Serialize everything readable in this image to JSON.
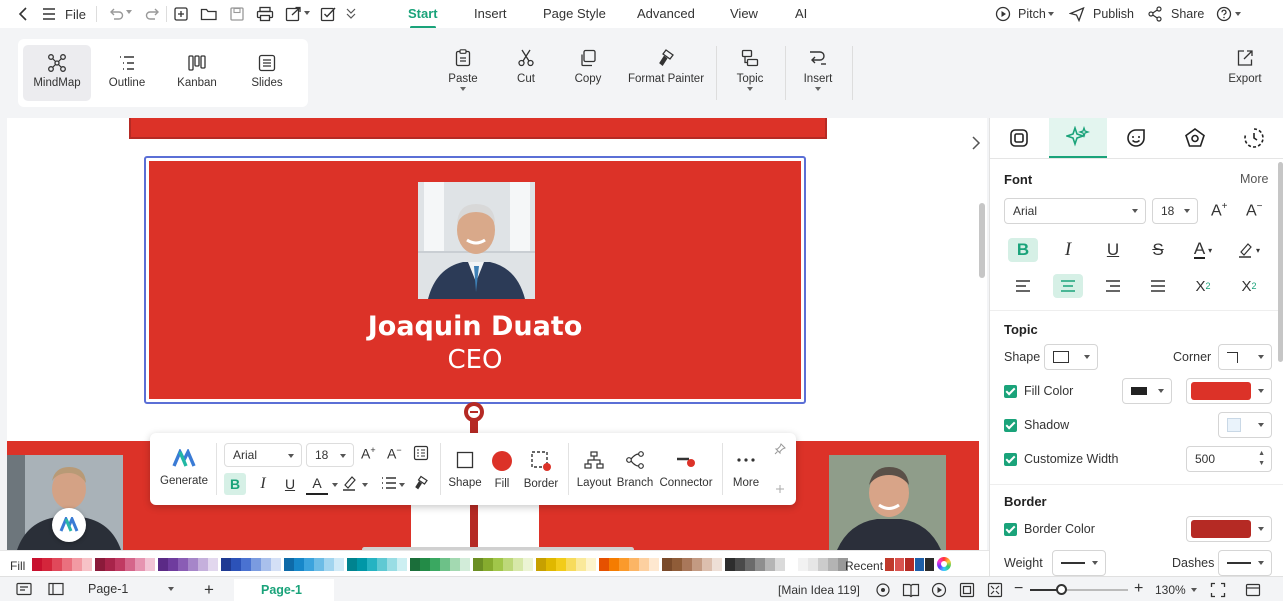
{
  "menubar": {
    "file_label": "File",
    "tabs": [
      "Start",
      "Insert",
      "Page Style",
      "Advanced",
      "View",
      "AI"
    ],
    "active_tab": "Start",
    "pitch_label": "Pitch",
    "publish_label": "Publish",
    "share_label": "Share"
  },
  "ribbon": {
    "views": [
      {
        "label": "MindMap",
        "icon": "mindmap-icon"
      },
      {
        "label": "Outline",
        "icon": "outline-icon"
      },
      {
        "label": "Kanban",
        "icon": "kanban-icon"
      },
      {
        "label": "Slides",
        "icon": "slides-icon"
      }
    ],
    "paste": "Paste",
    "cut": "Cut",
    "copy": "Copy",
    "format_painter": "Format Painter",
    "topic": "Topic",
    "insert": "Insert",
    "export": "Export"
  },
  "canvas": {
    "main_name": "Joaquin Duato",
    "main_title": "CEO",
    "topic_color": "#dc3228",
    "selection_color": "#5b6fd6"
  },
  "floating_toolbar": {
    "generate": "Generate",
    "font": "Arial",
    "size": "18",
    "shape": "Shape",
    "fill": "Fill",
    "border": "Border",
    "layout": "Layout",
    "branch": "Branch",
    "connector": "Connector",
    "more": "More"
  },
  "right_panel": {
    "font_section": "Font",
    "more": "More",
    "font_family": "Arial",
    "font_size": "18",
    "topic_section": "Topic",
    "shape_label": "Shape",
    "corner_label": "Corner",
    "fill_color_label": "Fill Color",
    "fill_color": "#dc3228",
    "shadow_label": "Shadow",
    "customize_width_label": "Customize Width",
    "width_value": "500",
    "border_section": "Border",
    "border_color_label": "Border Color",
    "border_color": "#b52a24",
    "weight_label": "Weight",
    "dashes_label": "Dashes"
  },
  "colorbar": {
    "fill_label": "Fill",
    "recent_label": "Recent",
    "swatches": [
      "#c8102e",
      "#d4253b",
      "#e0485a",
      "#ea707e",
      "#f29aa3",
      "#f7c2c7",
      "#8b1a3a",
      "#a8244a",
      "#c03a62",
      "#d5658a",
      "#e694b1",
      "#f2c4d5",
      "#5b2a86",
      "#6f3c9e",
      "#8a5db5",
      "#a686c9",
      "#c5b0dc",
      "#e2d7ee",
      "#1f3a93",
      "#2c52b8",
      "#4a72d1",
      "#7a9be0",
      "#a9c0ec",
      "#d4e0f6",
      "#0e6aa8",
      "#1787c9",
      "#3ba3dd",
      "#6cbce6",
      "#a2d5ef",
      "#d0eaf7",
      "#00838f",
      "#0097a7",
      "#26b3c2",
      "#5fc9d3",
      "#99dde4",
      "#ccefF2",
      "#1b6e3a",
      "#238b47",
      "#3aa861",
      "#6dc188",
      "#a3d9b1",
      "#d2ecd9",
      "#6b8e23",
      "#86ab2e",
      "#a1c64a",
      "#bdd87a",
      "#d7e8a9",
      "#ecf4d4",
      "#c7a000",
      "#e0b800",
      "#f2cc1a",
      "#f7db5c",
      "#fae99a",
      "#fdf4cc",
      "#e65100",
      "#f57c00",
      "#fb9a2b",
      "#fcb565",
      "#fdd0a0",
      "#fee8d0",
      "#7a4a2a",
      "#8f5c38",
      "#a9775a",
      "#c39a82",
      "#dcbfae",
      "#eedfd6",
      "#2d2d2d",
      "#4a4a4a",
      "#6b6b6b",
      "#8f8f8f",
      "#b5b5b5",
      "#dadada",
      "#ffffff",
      "#f2f2f2",
      "#e6e6e6",
      "#cccccc",
      "#b3b3b3",
      "#999999"
    ],
    "recent": [
      "#c0392b",
      "#d9534f",
      "#b52a24",
      "#1e5fa8",
      "#2b2b2b"
    ]
  },
  "statusbar": {
    "page_select": "Page-1",
    "active_page": "Page-1",
    "main_idea": "[Main Idea 119]",
    "zoom": "130%"
  }
}
